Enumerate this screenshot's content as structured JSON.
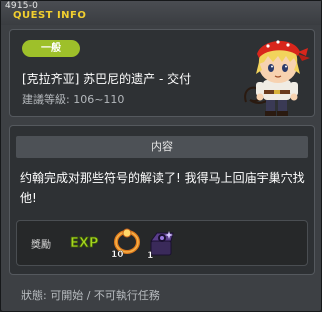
{
  "window": {
    "quest_id": "4915-0",
    "title": "QUEST INFO"
  },
  "quest": {
    "category": "一般",
    "name": "[克拉齐亚] 苏巴尼的遗产 - 交付",
    "level": "建議等級: 106~110"
  },
  "content": {
    "header": "内容",
    "text": "约翰完成对那些符号的解读了! 我得马上回庙宇巢穴找他!"
  },
  "rewards": {
    "label": "獎勵",
    "items": [
      {
        "icon": "exp-icon",
        "text": "EXP"
      },
      {
        "icon": "ring-icon",
        "count": "10"
      },
      {
        "icon": "chest-icon",
        "count": "1"
      }
    ]
  },
  "status": "狀態: 可開始 / 不可執行任務",
  "colors": {
    "title": "#f2cf2f",
    "badge": "#9ec02a",
    "exp": "#a6d61f"
  }
}
